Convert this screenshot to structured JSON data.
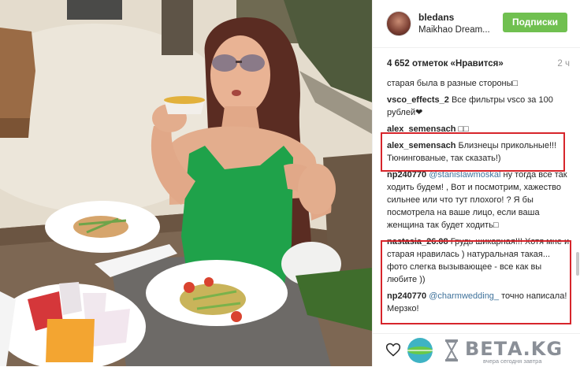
{
  "header": {
    "username": "bledans",
    "location": "Maikhao Dream...",
    "follow_label": "Подписки"
  },
  "stats": {
    "likes": "4 652 отметок «Нравится»",
    "time": "2 ч"
  },
  "comments": [
    {
      "user": "",
      "mention": "",
      "text": "старая была в разные стороны□"
    },
    {
      "user": "vsco_effects_2",
      "mention": "",
      "text": "Все фильтры vsco за 100 рублей❤"
    },
    {
      "user": "alex_semensach",
      "mention": "",
      "text": "□□"
    },
    {
      "user": "alex_semensach",
      "mention": "",
      "text": "Близнецы прикольные!!! Тюнингованые, так сказать!)"
    },
    {
      "user": "np240770",
      "mention": "@stanislawmoskal",
      "text": "ну тогда все так ходить будем! , Вот и посмотрим, хажество сильнее или что тут плохого! ? Я бы посмотрела на ваше лицо, если ваша женщина так будет ходить□"
    },
    {
      "user": "nastasia_26.08",
      "mention": "",
      "text": "Грудь шикарная!!! Хотя мне и старая нравилась ) натуральная такая... фото слегка вызывающее - все как вы любите ))"
    },
    {
      "user": "np240770",
      "mention": "@charmwedding_",
      "text": "точно написала! Мерзко!"
    }
  ],
  "watermark": {
    "brand": "ВЕТА.KG",
    "tagline": "вчера сегодня завтра"
  },
  "colors": {
    "follow_button": "#70c050",
    "highlight_box": "#d7252b",
    "mention_link": "#3f729b",
    "top_wrap_dress": "#1fa24a"
  },
  "icons": {
    "like": "heart-outline-icon",
    "watermark_logo": "globe-hourglass-logo"
  }
}
